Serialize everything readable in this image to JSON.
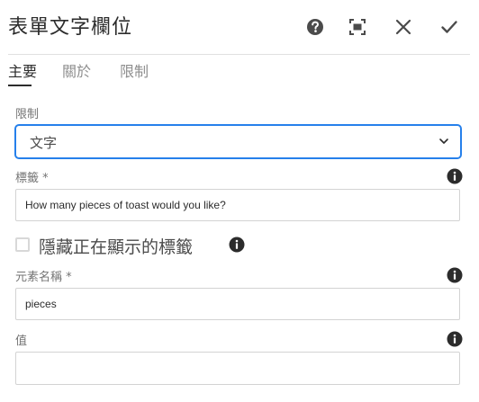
{
  "header": {
    "title": "表單文字欄位",
    "icons": [
      "help-icon",
      "fullscreen-icon",
      "close-icon",
      "check-icon"
    ]
  },
  "tabs": [
    {
      "label": "主要",
      "active": true
    },
    {
      "label": "關於",
      "active": false
    },
    {
      "label": "限制",
      "active": false
    }
  ],
  "form": {
    "constraint": {
      "label": "限制",
      "value": "文字"
    },
    "field_label": {
      "label": "標籤 *",
      "value": "How many pieces of toast would you like?"
    },
    "hide_label_checkbox": {
      "label": "隱藏正在顯示的標籤",
      "checked": false
    },
    "element_name": {
      "label": "元素名稱 *",
      "value": "pieces"
    },
    "value": {
      "label": "值",
      "value": ""
    }
  },
  "colors": {
    "accent": "#2680eb",
    "text": "#2c2c2c",
    "muted": "#747474",
    "border": "#d3d3d3"
  }
}
